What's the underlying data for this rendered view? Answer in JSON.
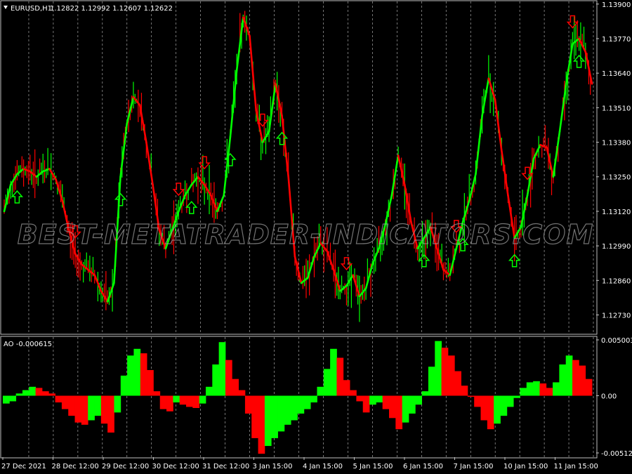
{
  "header": {
    "symbol_label": "EURUSD,H1",
    "ohlc": "1.12822 1.12992 1.12607 1.12622"
  },
  "watermark": "BEST-METATRADER-INDICATORS.COM",
  "colors": {
    "background": "#000000",
    "grid": "#c0c0c0",
    "bull": "#00ff00",
    "bear": "#ff0000",
    "text": "#ffffff"
  },
  "chart_data": [
    {
      "type": "line",
      "panel": "main",
      "title": "EURUSD,H1",
      "y_ticks": [
        1.1273,
        1.1286,
        1.1299,
        1.1312,
        1.1325,
        1.1338,
        1.1351,
        1.1364,
        1.1377,
        1.139
      ],
      "y_tick_labels": [
        "1.12730",
        "1.12860",
        "1.12990",
        "1.13120",
        "1.13250",
        "1.13380",
        "1.13510",
        "1.13640",
        "1.13770",
        "1.13900"
      ],
      "ylim": [
        1.1266,
        1.1391
      ],
      "x_labels": [
        "27 Dec 2021",
        "28 Dec 12:00",
        "29 Dec 12:00",
        "30 Dec 12:00",
        "31 Dec 12:00",
        "3 Jan 15:00",
        "4 Jan 15:00",
        "5 Jan 15:00",
        "6 Jan 15:00",
        "7 Jan 15:00",
        "10 Jan 15:00",
        "11 Jan 15:00"
      ],
      "grid": true,
      "series": [
        {
          "color": "mixed",
          "values": [
            1.1312,
            1.1322,
            1.1326,
            1.1328,
            1.1327,
            1.1325,
            1.1327,
            1.1328,
            1.1324,
            1.1316,
            1.1305,
            1.1296,
            1.1292,
            1.129,
            1.1288,
            1.1282,
            1.1278,
            1.1285,
            1.1325,
            1.1345,
            1.1355,
            1.1352,
            1.1338,
            1.1322,
            1.1305,
            1.1298,
            1.1305,
            1.1312,
            1.1318,
            1.1322,
            1.1325,
            1.1322,
            1.1318,
            1.1312,
            1.1318,
            1.134,
            1.1365,
            1.1385,
            1.1378,
            1.135,
            1.1338,
            1.1342,
            1.136,
            1.1348,
            1.1325,
            1.1295,
            1.1285,
            1.1287,
            1.1295,
            1.13,
            1.1297,
            1.129,
            1.1282,
            1.1284,
            1.1288,
            1.128,
            1.1283,
            1.1292,
            1.1298,
            1.1307,
            1.1318,
            1.1333,
            1.1322,
            1.1308,
            1.1298,
            1.1302,
            1.1306,
            1.1298,
            1.129,
            1.1288,
            1.1298,
            1.1308,
            1.1316,
            1.1326,
            1.1348,
            1.1362,
            1.1354,
            1.1335,
            1.1318,
            1.1302,
            1.1306,
            1.1318,
            1.1332,
            1.1337,
            1.1336,
            1.1325,
            1.1342,
            1.136,
            1.1375,
            1.1377,
            1.1372,
            1.136
          ]
        }
      ],
      "signals": {
        "buy_at_index": [
          2,
          18,
          29,
          35,
          43,
          65,
          71,
          79,
          89
        ],
        "sell_at_index": [
          11,
          27,
          31,
          40,
          53,
          70,
          81,
          88
        ]
      }
    },
    {
      "type": "bar",
      "panel": "indicator",
      "title": "AO -0.000615",
      "y_tick_labels": [
        "0.005003",
        "0.00",
        "-0.005126"
      ],
      "ylim": [
        -0.005126,
        0.005003
      ],
      "values": [
        -0.0007,
        -0.0005,
        0.0002,
        0.0005,
        0.0008,
        0.0007,
        0.0004,
        0.0002,
        -0.0006,
        -0.0012,
        -0.0018,
        -0.0024,
        -0.0026,
        -0.0022,
        -0.0018,
        -0.0025,
        -0.0033,
        -0.0015,
        0.0018,
        0.0036,
        0.0042,
        0.0038,
        0.0023,
        0.0004,
        -0.0012,
        -0.0014,
        -0.0006,
        -0.0008,
        -0.001,
        -0.0011,
        -0.0007,
        0.0008,
        0.0028,
        0.0048,
        0.0032,
        0.0015,
        0.0005,
        -0.0016,
        -0.0038,
        -0.0052,
        -0.0045,
        -0.0038,
        -0.0032,
        -0.0026,
        -0.0022,
        -0.0016,
        -0.0012,
        -0.0006,
        0.0008,
        0.0024,
        0.0042,
        0.0034,
        0.0014,
        0.0005,
        -0.0005,
        -0.0015,
        -0.0008,
        -0.0006,
        -0.0012,
        -0.002,
        -0.003,
        -0.0024,
        -0.0016,
        -0.0008,
        0.0004,
        0.0026,
        0.0049,
        0.0043,
        0.0036,
        0.0022,
        0.0009,
        -0.0001,
        -0.001,
        -0.0022,
        -0.003,
        -0.0025,
        -0.0018,
        -0.001,
        -0.0002,
        0.0007,
        0.0012,
        0.0013,
        0.0011,
        0.0007,
        0.0012,
        0.0028,
        0.0036,
        0.0032,
        0.0027,
        0.0015
      ]
    }
  ]
}
